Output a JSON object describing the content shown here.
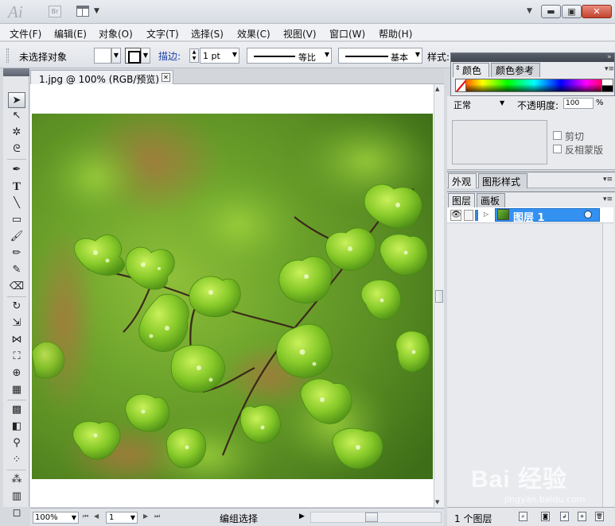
{
  "app": {
    "logo": "Ai",
    "bridge_badge": "Br"
  },
  "window_controls": {
    "minimize": "▬",
    "restore": "▣",
    "close": "✕"
  },
  "menu": [
    "文件(F)",
    "编辑(E)",
    "对象(O)",
    "文字(T)",
    "选择(S)",
    "效果(C)",
    "视图(V)",
    "窗口(W)",
    "帮助(H)"
  ],
  "control_bar": {
    "selection_status": "未选择对象",
    "stroke_label": "描边:",
    "stroke_weight": "1 pt",
    "variable_width_profile": "等比",
    "brush_definition": "基本",
    "style_label": "样式:"
  },
  "tools": [
    "selection-tool",
    "direct-selection-tool",
    "magic-wand-tool",
    "lasso-tool",
    "pen-tool",
    "type-tool",
    "line-segment-tool",
    "rectangle-tool",
    "paintbrush-tool",
    "pencil-tool",
    "blob-brush-tool",
    "eraser-tool",
    "rotate-tool",
    "scale-tool",
    "width-tool",
    "free-transform-tool",
    "shape-builder-tool",
    "perspective-grid-tool",
    "mesh-tool",
    "gradient-tool",
    "eyedropper-tool",
    "blend-tool",
    "symbol-sprayer-tool",
    "column-graph-tool",
    "artboard-tool"
  ],
  "document": {
    "tab_title": "1.jpg @ 100% (RGB/预览)",
    "close_glyph": "☒"
  },
  "status_bar": {
    "zoom": "100%",
    "page": "1",
    "status_text": "编组选择"
  },
  "color_panel": {
    "tab_color": "颜色",
    "tab_color_guide": "颜色参考"
  },
  "transparency_panel": {
    "blend_mode": "正常",
    "opacity_label": "不透明度:",
    "opacity_value": "100",
    "opacity_unit": "%",
    "clip_label": "剪切",
    "invert_mask_label": "反相蒙版"
  },
  "appearance_panel": {
    "tab_appearance": "外观",
    "tab_graphic_styles": "图形样式"
  },
  "layers_panel": {
    "tab_layers": "图层",
    "tab_artboards": "画板",
    "layers": [
      {
        "name": "图层 1",
        "color": "#3a7fd6",
        "visible": true,
        "selected": true
      }
    ],
    "count_text": "1 个图层"
  },
  "watermark": {
    "text": "Bai 经验",
    "url": "jingyan.baidu.com"
  },
  "colors": {
    "accent": "#3391f2",
    "stroke_label": "#1c3fa6"
  }
}
